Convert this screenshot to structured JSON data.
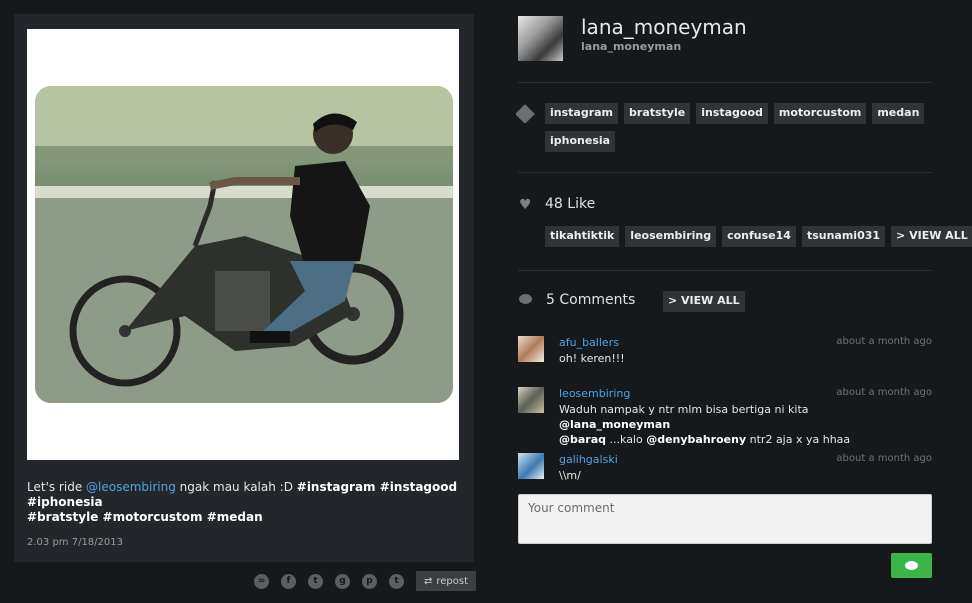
{
  "post": {
    "caption_lead": "Let's ride ",
    "caption_mention": "@leosembiring",
    "caption_middle": " ngak mau kalah :D ",
    "caption_tags_line1": "#instagram #instagood #iphonesia",
    "caption_tags_line2": "#bratstyle #motorcustom #medan",
    "posted_at": "2.03 pm 7/18/2013"
  },
  "share": {
    "icons": [
      "link-icon",
      "facebook-icon",
      "twitter-icon",
      "google-plus-icon",
      "pinterest-icon",
      "tumblr-icon"
    ],
    "repost_label": "repost"
  },
  "user": {
    "display_name": "lana_moneyman",
    "handle": "lana_moneyman"
  },
  "tags": [
    "instagram",
    "bratstyle",
    "instagood",
    "motorcustom",
    "medan",
    "iphonesia"
  ],
  "likes": {
    "count_label": "48 Like",
    "likers": [
      "tikahtiktik",
      "leosembiring",
      "confuse14",
      "tsunami031"
    ],
    "view_all_label": "> VIEW ALL"
  },
  "comments": {
    "count_label": "5 Comments",
    "view_all_label": "> VIEW ALL",
    "items": [
      {
        "user": "afu_ballers",
        "time": "about a month ago",
        "text": "oh! keren!!!"
      },
      {
        "user": "leosembiring",
        "time": "about a month ago",
        "text_a": "Waduh nampak y ntr mlm bisa bertiga ni kita ",
        "mention_a": "@lana_moneyman",
        "mention_b": "@baraq",
        "text_b": " ...kalo ",
        "mention_c": "@denybahroeny",
        "text_c": " ntr2 aja x ya hhaa"
      },
      {
        "user": "galihgalski",
        "time": "about a month ago",
        "text": "\\\\m/"
      }
    ],
    "input_placeholder": "Your comment"
  }
}
